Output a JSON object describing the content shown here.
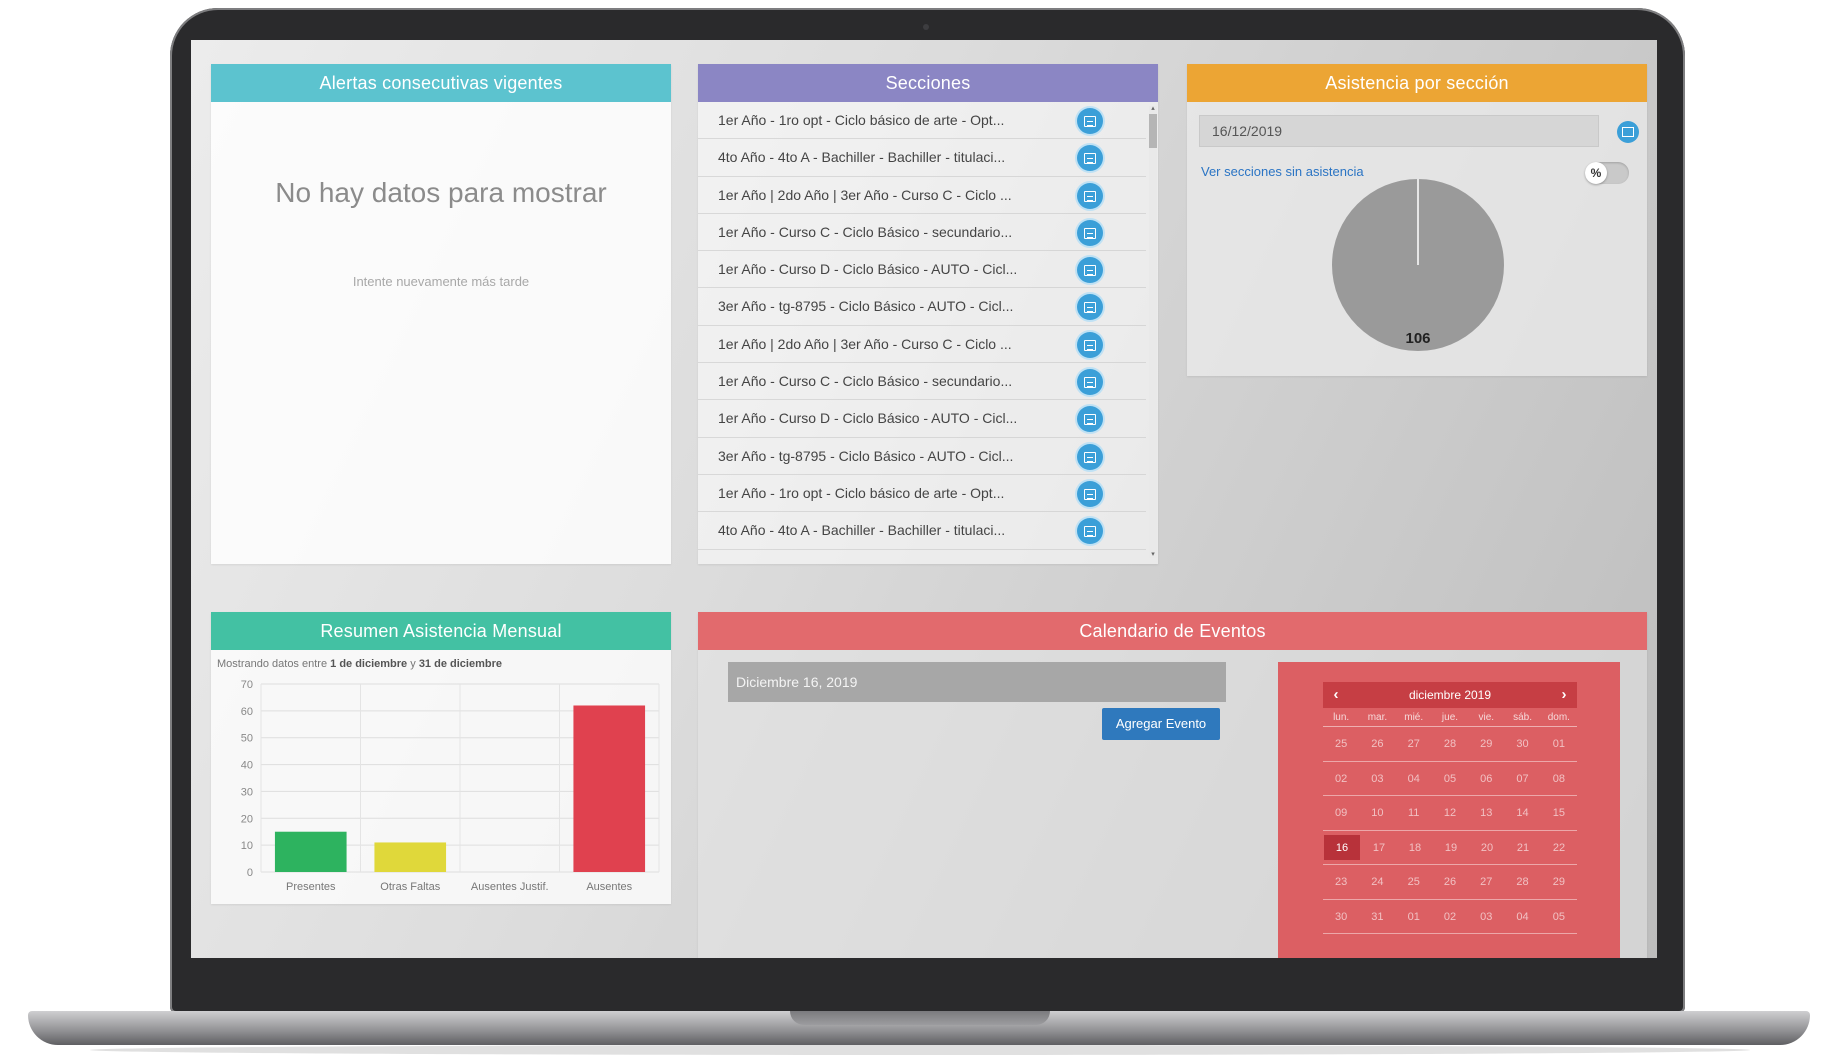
{
  "alerts": {
    "title": "Alertas consecutivas vigentes",
    "empty_title": "No hay datos para mostrar",
    "empty_subtitle": "Intente nuevamente más tarde"
  },
  "sections": {
    "title": "Secciones",
    "items": [
      "1er Año - 1ro opt - Ciclo básico de arte - Opt...",
      "4to Año - 4to A - Bachiller - Bachiller - titulaci...",
      "1er Año | 2do Año | 3er Año - Curso C - Ciclo ...",
      "1er Año - Curso C - Ciclo Básico - secundario...",
      "1er Año - Curso D - Ciclo Básico - AUTO - Cicl...",
      "3er Año - tg-8795 - Ciclo Básico - AUTO - Cicl...",
      "1er Año | 2do Año | 3er Año - Curso C - Ciclo ...",
      "1er Año - Curso C - Ciclo Básico - secundario...",
      "1er Año - Curso D - Ciclo Básico - AUTO - Cicl...",
      "3er Año - tg-8795 - Ciclo Básico - AUTO - Cicl...",
      "1er Año - 1ro opt - Ciclo básico de arte - Opt...",
      "4to Año - 4to A - Bachiller - Bachiller - titulaci..."
    ],
    "item_icon": "calendar-icon"
  },
  "attendance_by_section": {
    "title": "Asistencia por sección",
    "date_value": "16/12/2019",
    "no_attendance_link": "Ver secciones sin asistencia",
    "percent_toggle_label": "%",
    "pie_value": "106",
    "pie_color": "#9a9a9a"
  },
  "monthly_summary": {
    "title": "Resumen Asistencia Mensual",
    "range_prefix": "Mostrando datos entre",
    "range_from": "1 de diciembre",
    "range_joiner": "y",
    "range_to": "31 de diciembre"
  },
  "chart_data": {
    "type": "bar",
    "categories": [
      "Presentes",
      "Otras Faltas",
      "Ausentes Justif.",
      "Ausentes"
    ],
    "values": [
      15,
      11,
      0,
      62
    ],
    "colors": [
      "#2db35f",
      "#e0d83a",
      "#9e9e9e",
      "#e0414f"
    ],
    "ylim": [
      0,
      70
    ],
    "yticks": [
      0,
      10,
      20,
      30,
      40,
      50,
      60,
      70
    ],
    "grid": true
  },
  "events": {
    "title": "Calendario de Eventos",
    "date_display": "Diciembre 16, 2019",
    "add_button": "Agregar Evento",
    "calendar": {
      "month_label": "diciembre 2019",
      "prev": "‹",
      "next": "›",
      "weekdays": [
        "lun.",
        "mar.",
        "mié.",
        "jue.",
        "vie.",
        "sáb.",
        "dom."
      ],
      "weeks": [
        [
          "25",
          "26",
          "27",
          "28",
          "29",
          "30",
          "01"
        ],
        [
          "02",
          "03",
          "04",
          "05",
          "06",
          "07",
          "08"
        ],
        [
          "09",
          "10",
          "11",
          "12",
          "13",
          "14",
          "15"
        ],
        [
          "16",
          "17",
          "18",
          "19",
          "20",
          "21",
          "22"
        ],
        [
          "23",
          "24",
          "25",
          "26",
          "27",
          "28",
          "29"
        ],
        [
          "30",
          "31",
          "01",
          "02",
          "03",
          "04",
          "05"
        ]
      ],
      "selected": "16"
    }
  }
}
